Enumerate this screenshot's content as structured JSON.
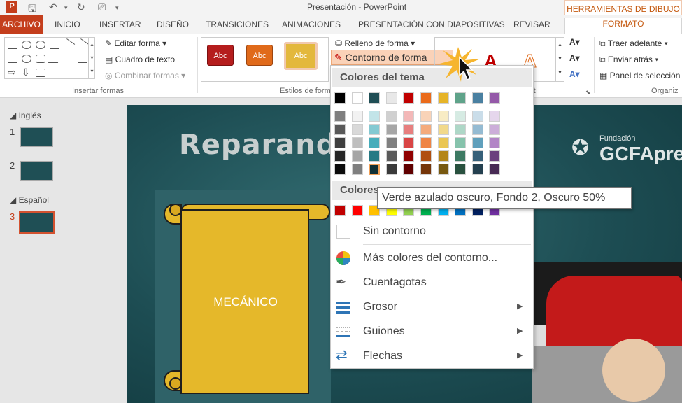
{
  "window": {
    "title": "Presentación - PowerPoint",
    "context_group": "HERRAMIENTAS DE DIBUJO"
  },
  "tabs": [
    "ARCHIVO",
    "INICIO",
    "INSERTAR",
    "DISEÑO",
    "TRANSICIONES",
    "ANIMACIONES",
    "PRESENTACIÓN CON DIAPOSITIVAS",
    "REVISAR",
    "FORMATO"
  ],
  "ribbon": {
    "insert_shapes": {
      "edit_shape": "Editar forma",
      "text_box": "Cuadro de texto",
      "merge_shapes": "Combinar formas",
      "label": "Insertar formas"
    },
    "shape_styles": {
      "fill": "Relleno de forma",
      "outline": "Contorno de forma",
      "label": "Estilos de forma",
      "style_text": "Abc",
      "wordart_label": "rt"
    },
    "arrange": {
      "bring_forward": "Traer adelante",
      "send_backward": "Enviar atrás",
      "selection_pane": "Panel de selección",
      "label": "Organiz"
    }
  },
  "slides_pane": {
    "sections": [
      "Inglés",
      "Español"
    ],
    "numbers": [
      "1",
      "2",
      "3"
    ]
  },
  "slide": {
    "title": "Reparando",
    "scroll_text": "MECÁNICO",
    "brand_small": "Fundación",
    "brand_large": "GCFAprer"
  },
  "menu": {
    "theme_header": "Colores del tema",
    "standard_header": "Colores",
    "no_outline": "Sin contorno",
    "more_colors": "Más colores del contorno...",
    "eyedropper": "Cuentagotas",
    "weight": "Grosor",
    "dashes": "Guiones",
    "arrows": "Flechas",
    "tooltip": "Verde azulado oscuro, Fondo 2, Oscuro 50%",
    "theme_colors": [
      [
        "#000000",
        "#ffffff",
        "#1f4e55",
        "#e8e8e8",
        "#c00000",
        "#ea6b1b",
        "#e6b428",
        "#5fa38a",
        "#4a80a1",
        "#9459a8"
      ],
      [
        "#7f7f7f",
        "#f2f2f2",
        "#c2e4e8",
        "#d0d0d0",
        "#f3b8b8",
        "#f9d3b8",
        "#f8ecc4",
        "#d6ebe3",
        "#cadde9",
        "#e5d6ec"
      ],
      [
        "#595959",
        "#d9d9d9",
        "#84c9d2",
        "#a6a6a6",
        "#e77f7f",
        "#f4ab7c",
        "#f1d98b",
        "#aed7c7",
        "#95bbd2",
        "#ccaed9"
      ],
      [
        "#3f3f3f",
        "#bfbfbf",
        "#47adbb",
        "#808080",
        "#d94545",
        "#ef8546",
        "#eac653",
        "#86c3ac",
        "#60a0bc",
        "#b285c6"
      ],
      [
        "#262626",
        "#a5a5a5",
        "#277a84",
        "#5a5a5a",
        "#900000",
        "#b04f10",
        "#b48619",
        "#3d7a63",
        "#366079",
        "#6b3f7e"
      ],
      [
        "#0c0c0c",
        "#7f7f7f",
        "#103136",
        "#3a3a3a",
        "#600000",
        "#753509",
        "#785910",
        "#29513f",
        "#24404f",
        "#472a54"
      ]
    ],
    "standard_colors": [
      "#c00000",
      "#ff0000",
      "#ffc000",
      "#ffff00",
      "#92d050",
      "#00b050",
      "#00b0f0",
      "#0070c0",
      "#002060",
      "#7030a0"
    ]
  }
}
